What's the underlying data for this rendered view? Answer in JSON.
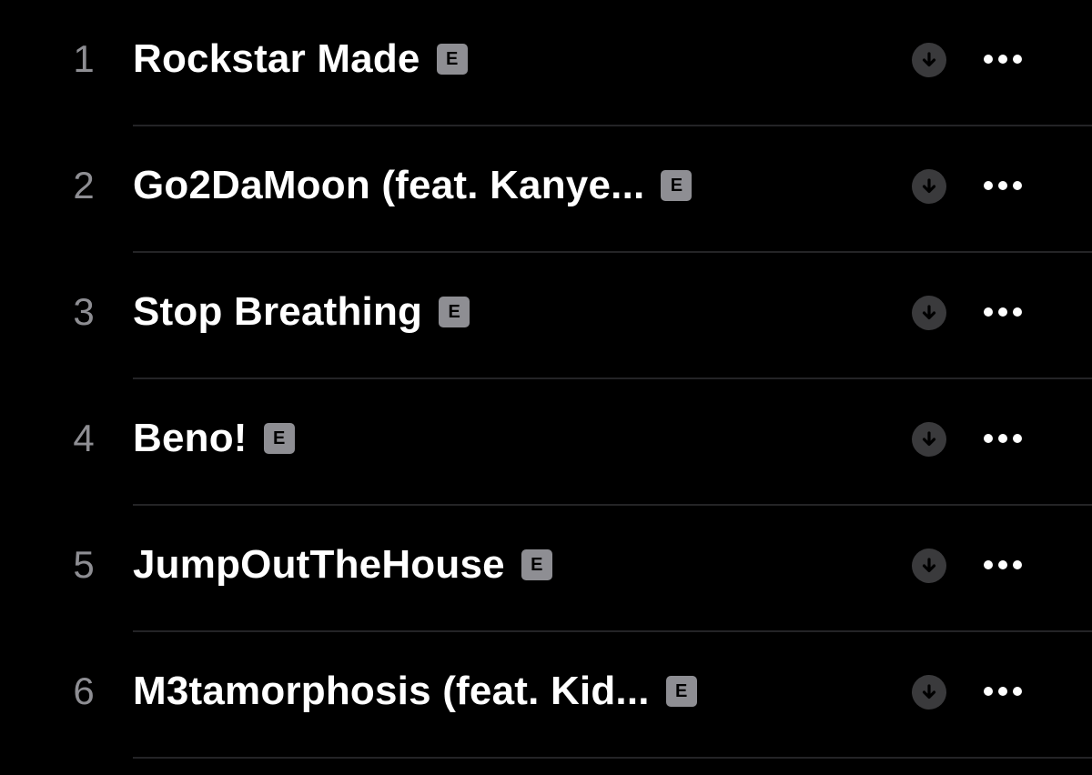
{
  "colors": {
    "background": "#000000",
    "title": "#ffffff",
    "number": "#8e8e93",
    "badge": "#8e8e93",
    "download_bg": "#3a3a3c",
    "divider": "#242426"
  },
  "tracks": [
    {
      "number": "1",
      "title": "Rockstar Made",
      "explicit": "E",
      "download_icon": "arrow-down-circle-icon",
      "more_icon": "ellipsis-icon"
    },
    {
      "number": "2",
      "title": "Go2DaMoon (feat. Kanye...",
      "explicit": "E",
      "download_icon": "arrow-down-circle-icon",
      "more_icon": "ellipsis-icon"
    },
    {
      "number": "3",
      "title": "Stop Breathing",
      "explicit": "E",
      "download_icon": "arrow-down-circle-icon",
      "more_icon": "ellipsis-icon"
    },
    {
      "number": "4",
      "title": "Beno!",
      "explicit": "E",
      "download_icon": "arrow-down-circle-icon",
      "more_icon": "ellipsis-icon"
    },
    {
      "number": "5",
      "title": "JumpOutTheHouse",
      "explicit": "E",
      "download_icon": "arrow-down-circle-icon",
      "more_icon": "ellipsis-icon"
    },
    {
      "number": "6",
      "title": "M3tamorphosis (feat. Kid...",
      "explicit": "E",
      "download_icon": "arrow-down-circle-icon",
      "more_icon": "ellipsis-icon"
    }
  ]
}
